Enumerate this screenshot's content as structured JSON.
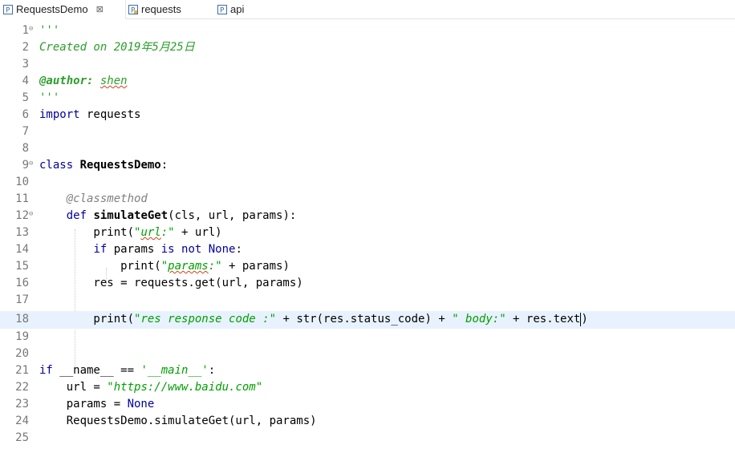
{
  "tabs": [
    {
      "label": "RequestsDemo",
      "close": "⊠",
      "icon": "python-file-icon"
    },
    {
      "label": "requests",
      "icon": "python-package-icon"
    },
    {
      "label": "api",
      "icon": "python-file-icon"
    }
  ],
  "colors": {
    "keyword": "#00009e",
    "string": "#00a000",
    "comment": "#2a9e2a",
    "decorator": "#808080",
    "current_line": "#e8f2fe",
    "line_number": "#787878"
  },
  "lines": [
    {
      "n": "1",
      "parts": [
        "'''"
      ]
    },
    {
      "n": "2",
      "parts": [
        "Created on 2019年5月25日"
      ]
    },
    {
      "n": "3",
      "parts": [
        ""
      ]
    },
    {
      "n": "4",
      "parts": [
        "@author:",
        " ",
        "shen"
      ]
    },
    {
      "n": "5",
      "parts": [
        "'''"
      ]
    },
    {
      "n": "6",
      "parts": [
        "import",
        " requests"
      ]
    },
    {
      "n": "7",
      "parts": [
        ""
      ]
    },
    {
      "n": "8",
      "parts": [
        ""
      ]
    },
    {
      "n": "9",
      "parts": [
        "class",
        " ",
        "RequestsDemo",
        ":"
      ]
    },
    {
      "n": "10",
      "parts": [
        ""
      ]
    },
    {
      "n": "11",
      "parts": [
        "    ",
        "@classmethod"
      ]
    },
    {
      "n": "12",
      "parts": [
        "    ",
        "def",
        " ",
        "simulateGet",
        "(cls, url, params):"
      ]
    },
    {
      "n": "13",
      "parts": [
        "        print(",
        "\"",
        "url",
        ":\"",
        " + url)"
      ]
    },
    {
      "n": "14",
      "parts": [
        "        ",
        "if",
        " params ",
        "is not",
        " ",
        "None",
        ":"
      ]
    },
    {
      "n": "15",
      "parts": [
        "            print(",
        "\"",
        "params",
        ":\"",
        " + params)"
      ]
    },
    {
      "n": "16",
      "parts": [
        "        res = requests.get(url, params)"
      ]
    },
    {
      "n": "17",
      "parts": [
        ""
      ]
    },
    {
      "n": "18",
      "parts": [
        "        print(",
        "\"res response code :\"",
        " + str(res.status_code) + ",
        "\" body:\"",
        " + res.text",
        ")"
      ]
    },
    {
      "n": "19",
      "parts": [
        ""
      ]
    },
    {
      "n": "20",
      "parts": [
        ""
      ]
    },
    {
      "n": "21",
      "parts": [
        "if",
        " __name__ == ",
        "'__main__'",
        ":"
      ]
    },
    {
      "n": "22",
      "parts": [
        "    url = ",
        "\"https://www.baidu.com\""
      ]
    },
    {
      "n": "23",
      "parts": [
        "    params = ",
        "None"
      ]
    },
    {
      "n": "24",
      "parts": [
        "    RequestsDemo.simulateGet(url, params)"
      ]
    },
    {
      "n": "25",
      "parts": [
        ""
      ]
    }
  ]
}
